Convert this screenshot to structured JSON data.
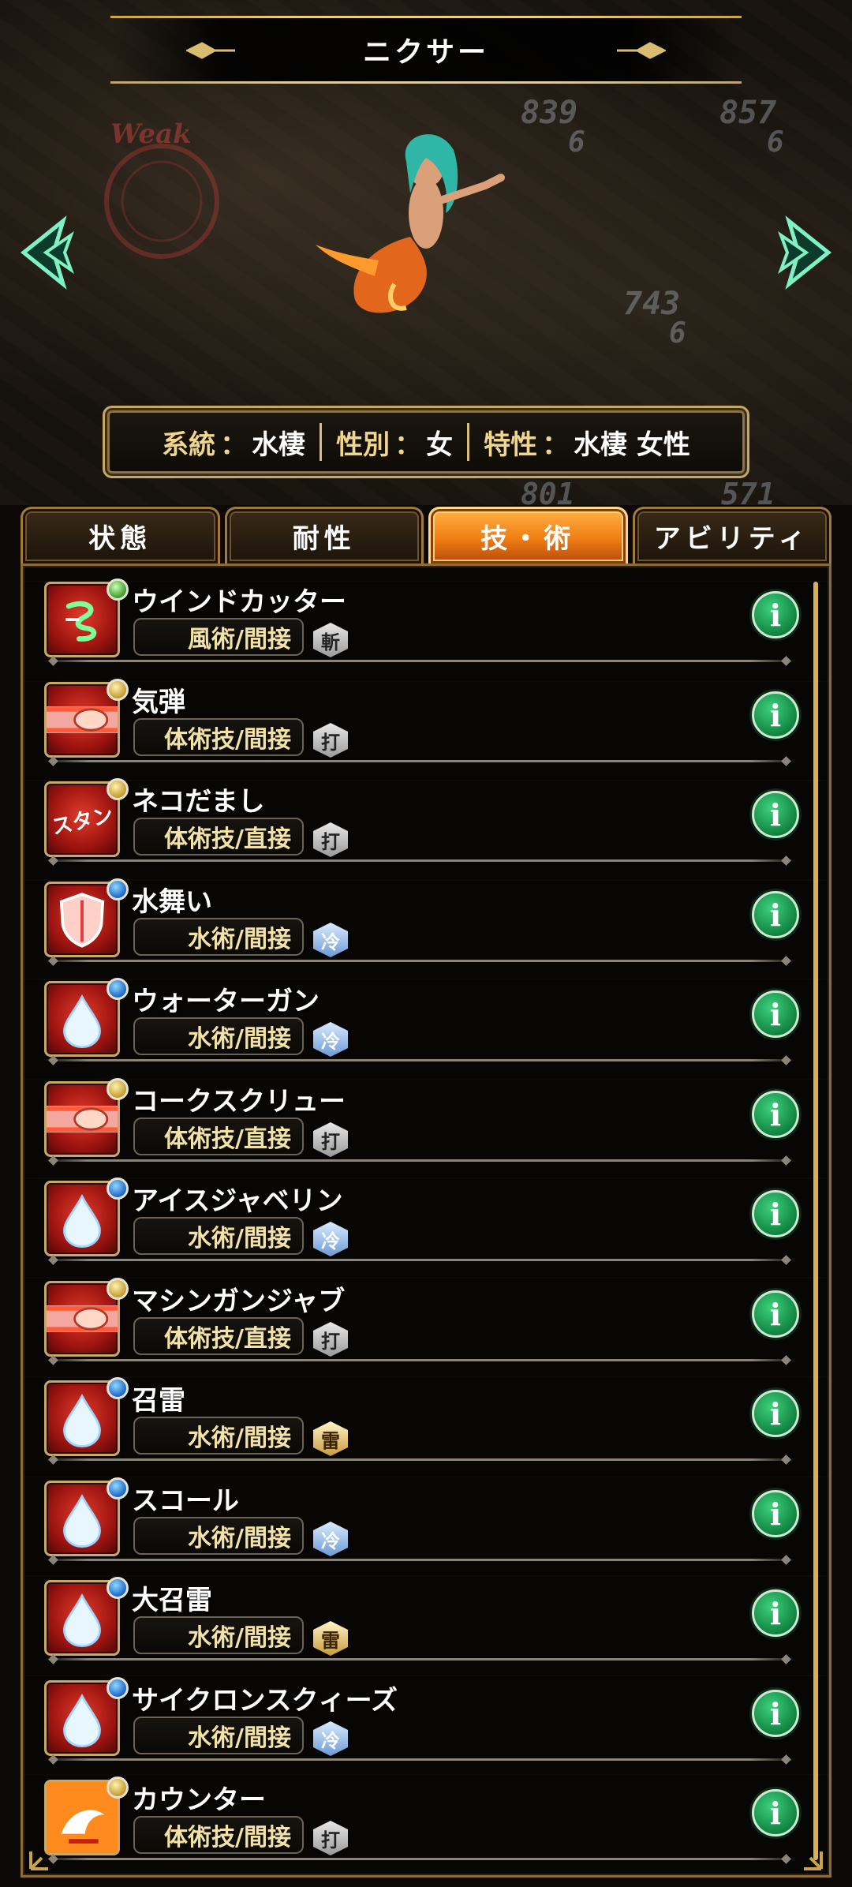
{
  "header": {
    "title": "ニクサー"
  },
  "scene": {
    "weak_label": "Weak",
    "enemy_numbers": [
      {
        "hp": "839",
        "sub": "6"
      },
      {
        "hp": "857",
        "sub": "6"
      },
      {
        "hp": "743",
        "sub": "6"
      },
      {
        "hp": "801",
        "sub": ""
      },
      {
        "hp": "571",
        "sub": ""
      }
    ]
  },
  "info": {
    "lineage_key": "系統",
    "lineage_val": "水棲",
    "gender_key": "性別",
    "gender_val": "女",
    "trait_key": "特性",
    "trait_val": "水棲 女性"
  },
  "tabs": [
    {
      "label": "状態",
      "active": false
    },
    {
      "label": "耐性",
      "active": false
    },
    {
      "label": "技・術",
      "active": true
    },
    {
      "label": "アビリティ",
      "active": false
    }
  ],
  "skills": [
    {
      "name": "ウインドカッター",
      "type": "風術/間接",
      "element": "斬",
      "icon": "wind-icon",
      "badge": "green"
    },
    {
      "name": "気弾",
      "type": "体術技/間接",
      "element": "打",
      "icon": "punch-icon",
      "badge": "gold"
    },
    {
      "name": "ネコだまし",
      "type": "体術技/直接",
      "element": "打",
      "icon": "stun-icon",
      "badge": "gold"
    },
    {
      "name": "水舞い",
      "type": "水術/間接",
      "element": "冷",
      "icon": "shield-icon",
      "badge": "blue"
    },
    {
      "name": "ウォーターガン",
      "type": "水術/間接",
      "element": "冷",
      "icon": "water-drop-icon",
      "badge": "blue"
    },
    {
      "name": "コークスクリュー",
      "type": "体術技/直接",
      "element": "打",
      "icon": "punch-icon",
      "badge": "gold"
    },
    {
      "name": "アイスジャベリン",
      "type": "水術/間接",
      "element": "冷",
      "icon": "water-drop-icon",
      "badge": "blue"
    },
    {
      "name": "マシンガンジャブ",
      "type": "体術技/直接",
      "element": "打",
      "icon": "punch-icon",
      "badge": "gold"
    },
    {
      "name": "召雷",
      "type": "水術/間接",
      "element": "雷",
      "icon": "water-drop-icon",
      "badge": "blue"
    },
    {
      "name": "スコール",
      "type": "水術/間接",
      "element": "冷",
      "icon": "water-drop-icon",
      "badge": "blue"
    },
    {
      "name": "大召雷",
      "type": "水術/間接",
      "element": "雷",
      "icon": "water-drop-icon",
      "badge": "blue"
    },
    {
      "name": "サイクロンスクィーズ",
      "type": "水術/間接",
      "element": "冷",
      "icon": "water-drop-icon",
      "badge": "blue"
    },
    {
      "name": "カウンター",
      "type": "体術技/間接",
      "element": "打",
      "icon": "counter-icon",
      "badge": "gold"
    }
  ],
  "info_button_glyph": "i",
  "colors": {
    "accent_gold": "#c9a44a",
    "tab_active": "#f07d12",
    "info_green": "#148a45"
  }
}
